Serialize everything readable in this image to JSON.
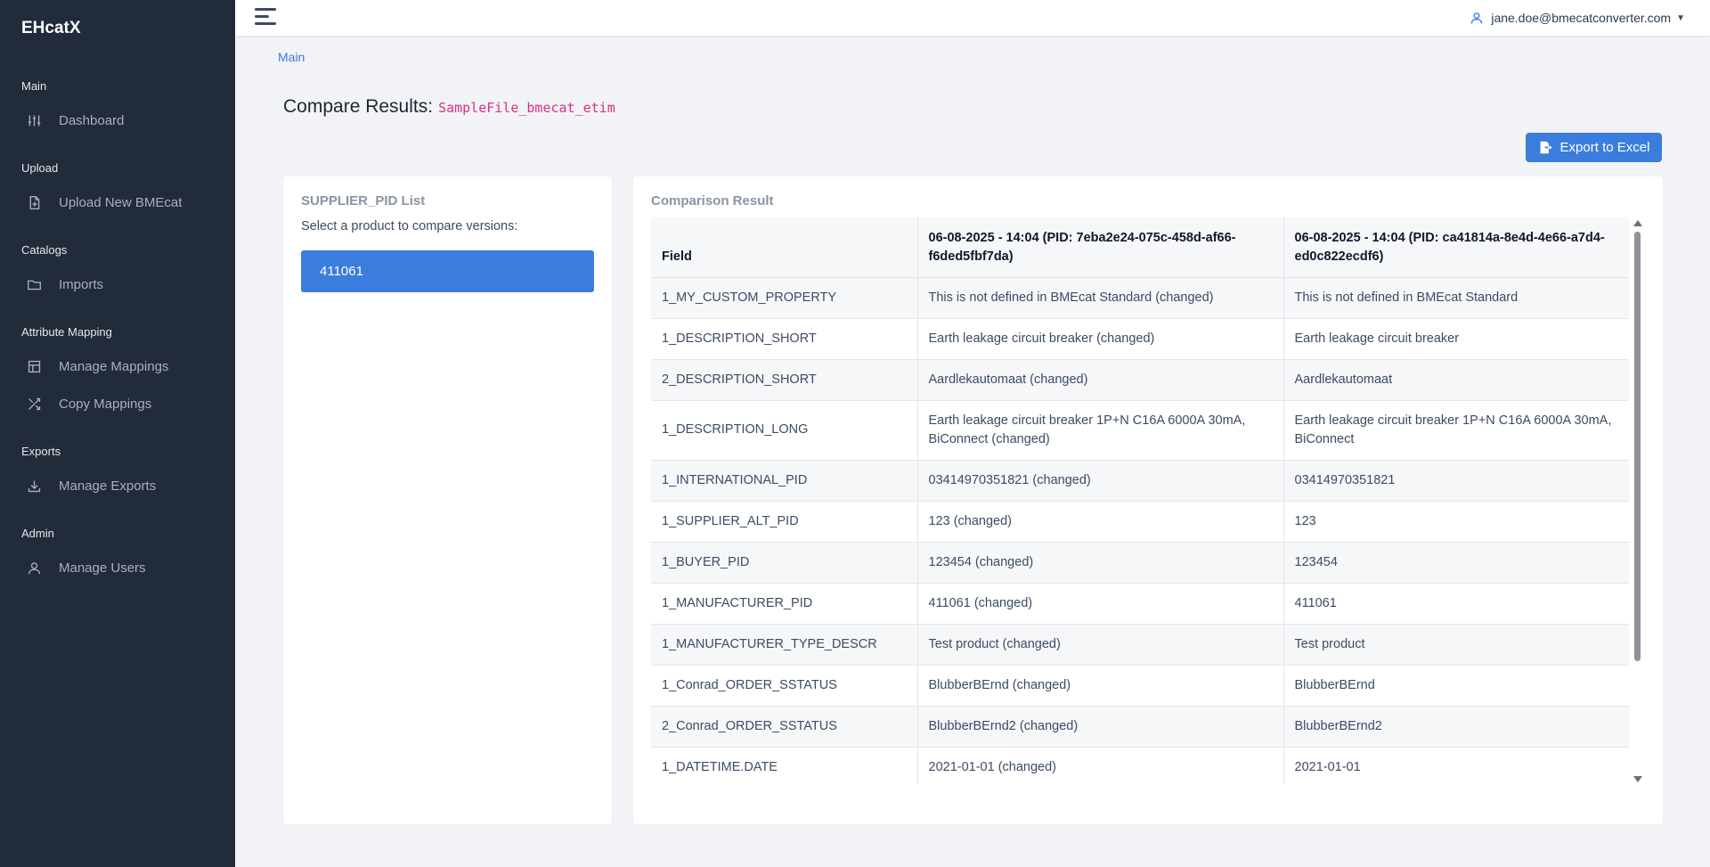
{
  "app": {
    "brand": "EHcatX"
  },
  "sidebar": {
    "sections": [
      {
        "title": "Main",
        "items": [
          {
            "label": "Dashboard",
            "icon": "sliders-icon"
          }
        ]
      },
      {
        "title": "Upload",
        "items": [
          {
            "label": "Upload New BMEcat",
            "icon": "file-plus-icon"
          }
        ]
      },
      {
        "title": "Catalogs",
        "items": [
          {
            "label": "Imports",
            "icon": "folder-icon"
          }
        ]
      },
      {
        "title": "Attribute Mapping",
        "items": [
          {
            "label": "Manage Mappings",
            "icon": "table-icon"
          },
          {
            "label": "Copy Mappings",
            "icon": "shuffle-icon"
          }
        ]
      },
      {
        "title": "Exports",
        "items": [
          {
            "label": "Manage Exports",
            "icon": "download-icon"
          }
        ]
      },
      {
        "title": "Admin",
        "items": [
          {
            "label": "Manage Users",
            "icon": "user-icon"
          }
        ]
      }
    ]
  },
  "header": {
    "user_email": "jane.doe@bmecatconverter.com"
  },
  "breadcrumb": {
    "main": "Main"
  },
  "page": {
    "title": "Compare Results:",
    "filename": "SampleFile_bmecat_etim",
    "export_label": "Export to Excel"
  },
  "supplier_list": {
    "title": "SUPPLIER_PID List",
    "subtitle": "Select a product to compare versions:",
    "items": [
      "411061"
    ]
  },
  "comparison": {
    "title": "Comparison Result",
    "headers": [
      "Field",
      "06-08-2025 - 14:04 (PID: 7eba2e24-075c-458d-af66-f6ded5fbf7da)",
      "06-08-2025 - 14:04 (PID: ca41814a-8e4d-4e66-a7d4-ed0c822ecdf6)"
    ],
    "rows": [
      [
        "1_MY_CUSTOM_PROPERTY",
        "This is not defined in BMEcat Standard (changed)",
        "This is not defined in BMEcat Standard"
      ],
      [
        "1_DESCRIPTION_SHORT",
        "Earth leakage circuit breaker (changed)",
        "Earth leakage circuit breaker"
      ],
      [
        "2_DESCRIPTION_SHORT",
        "Aardlekautomaat (changed)",
        "Aardlekautomaat"
      ],
      [
        "1_DESCRIPTION_LONG",
        "Earth leakage circuit breaker 1P+N C16A 6000A 30mA, BiConnect (changed)",
        "Earth leakage circuit breaker 1P+N C16A 6000A 30mA, BiConnect"
      ],
      [
        "1_INTERNATIONAL_PID",
        "03414970351821 (changed)",
        "03414970351821"
      ],
      [
        "1_SUPPLIER_ALT_PID",
        "123 (changed)",
        "123"
      ],
      [
        "1_BUYER_PID",
        "123454 (changed)",
        "123454"
      ],
      [
        "1_MANUFACTURER_PID",
        "411061 (changed)",
        "411061"
      ],
      [
        "1_MANUFACTURER_TYPE_DESCR",
        "Test product (changed)",
        "Test product"
      ],
      [
        "1_Conrad_ORDER_SSTATUS",
        "BlubberBErnd (changed)",
        "BlubberBErnd"
      ],
      [
        "2_Conrad_ORDER_SSTATUS",
        "BlubberBErnd2 (changed)",
        "BlubberBErnd2"
      ],
      [
        "1_DATETIME.DATE",
        "2021-01-01 (changed)",
        "2021-01-01"
      ]
    ]
  },
  "colors": {
    "sidebar_bg": "#212b3a",
    "primary": "#3b7ddd",
    "filename": "#d63384"
  }
}
